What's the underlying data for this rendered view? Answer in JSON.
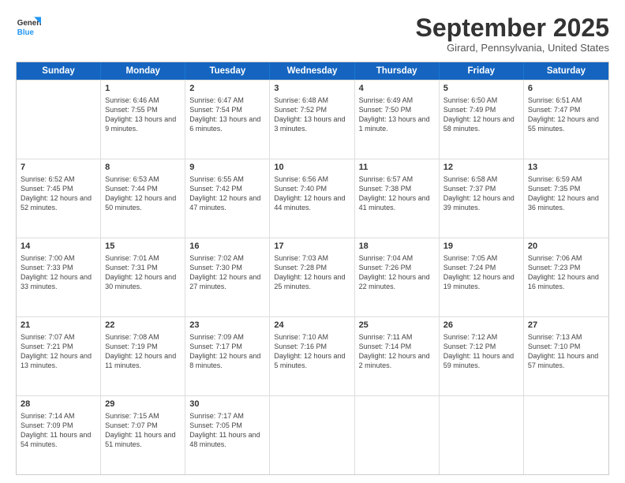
{
  "logo": {
    "general": "General",
    "blue": "Blue"
  },
  "title": "September 2025",
  "location": "Girard, Pennsylvania, United States",
  "days_of_week": [
    "Sunday",
    "Monday",
    "Tuesday",
    "Wednesday",
    "Thursday",
    "Friday",
    "Saturday"
  ],
  "weeks": [
    [
      {
        "day": "",
        "sunrise": "",
        "sunset": "",
        "daylight": ""
      },
      {
        "day": "1",
        "sunrise": "Sunrise: 6:46 AM",
        "sunset": "Sunset: 7:55 PM",
        "daylight": "Daylight: 13 hours and 9 minutes."
      },
      {
        "day": "2",
        "sunrise": "Sunrise: 6:47 AM",
        "sunset": "Sunset: 7:54 PM",
        "daylight": "Daylight: 13 hours and 6 minutes."
      },
      {
        "day": "3",
        "sunrise": "Sunrise: 6:48 AM",
        "sunset": "Sunset: 7:52 PM",
        "daylight": "Daylight: 13 hours and 3 minutes."
      },
      {
        "day": "4",
        "sunrise": "Sunrise: 6:49 AM",
        "sunset": "Sunset: 7:50 PM",
        "daylight": "Daylight: 13 hours and 1 minute."
      },
      {
        "day": "5",
        "sunrise": "Sunrise: 6:50 AM",
        "sunset": "Sunset: 7:49 PM",
        "daylight": "Daylight: 12 hours and 58 minutes."
      },
      {
        "day": "6",
        "sunrise": "Sunrise: 6:51 AM",
        "sunset": "Sunset: 7:47 PM",
        "daylight": "Daylight: 12 hours and 55 minutes."
      }
    ],
    [
      {
        "day": "7",
        "sunrise": "Sunrise: 6:52 AM",
        "sunset": "Sunset: 7:45 PM",
        "daylight": "Daylight: 12 hours and 52 minutes."
      },
      {
        "day": "8",
        "sunrise": "Sunrise: 6:53 AM",
        "sunset": "Sunset: 7:44 PM",
        "daylight": "Daylight: 12 hours and 50 minutes."
      },
      {
        "day": "9",
        "sunrise": "Sunrise: 6:55 AM",
        "sunset": "Sunset: 7:42 PM",
        "daylight": "Daylight: 12 hours and 47 minutes."
      },
      {
        "day": "10",
        "sunrise": "Sunrise: 6:56 AM",
        "sunset": "Sunset: 7:40 PM",
        "daylight": "Daylight: 12 hours and 44 minutes."
      },
      {
        "day": "11",
        "sunrise": "Sunrise: 6:57 AM",
        "sunset": "Sunset: 7:38 PM",
        "daylight": "Daylight: 12 hours and 41 minutes."
      },
      {
        "day": "12",
        "sunrise": "Sunrise: 6:58 AM",
        "sunset": "Sunset: 7:37 PM",
        "daylight": "Daylight: 12 hours and 39 minutes."
      },
      {
        "day": "13",
        "sunrise": "Sunrise: 6:59 AM",
        "sunset": "Sunset: 7:35 PM",
        "daylight": "Daylight: 12 hours and 36 minutes."
      }
    ],
    [
      {
        "day": "14",
        "sunrise": "Sunrise: 7:00 AM",
        "sunset": "Sunset: 7:33 PM",
        "daylight": "Daylight: 12 hours and 33 minutes."
      },
      {
        "day": "15",
        "sunrise": "Sunrise: 7:01 AM",
        "sunset": "Sunset: 7:31 PM",
        "daylight": "Daylight: 12 hours and 30 minutes."
      },
      {
        "day": "16",
        "sunrise": "Sunrise: 7:02 AM",
        "sunset": "Sunset: 7:30 PM",
        "daylight": "Daylight: 12 hours and 27 minutes."
      },
      {
        "day": "17",
        "sunrise": "Sunrise: 7:03 AM",
        "sunset": "Sunset: 7:28 PM",
        "daylight": "Daylight: 12 hours and 25 minutes."
      },
      {
        "day": "18",
        "sunrise": "Sunrise: 7:04 AM",
        "sunset": "Sunset: 7:26 PM",
        "daylight": "Daylight: 12 hours and 22 minutes."
      },
      {
        "day": "19",
        "sunrise": "Sunrise: 7:05 AM",
        "sunset": "Sunset: 7:24 PM",
        "daylight": "Daylight: 12 hours and 19 minutes."
      },
      {
        "day": "20",
        "sunrise": "Sunrise: 7:06 AM",
        "sunset": "Sunset: 7:23 PM",
        "daylight": "Daylight: 12 hours and 16 minutes."
      }
    ],
    [
      {
        "day": "21",
        "sunrise": "Sunrise: 7:07 AM",
        "sunset": "Sunset: 7:21 PM",
        "daylight": "Daylight: 12 hours and 13 minutes."
      },
      {
        "day": "22",
        "sunrise": "Sunrise: 7:08 AM",
        "sunset": "Sunset: 7:19 PM",
        "daylight": "Daylight: 12 hours and 11 minutes."
      },
      {
        "day": "23",
        "sunrise": "Sunrise: 7:09 AM",
        "sunset": "Sunset: 7:17 PM",
        "daylight": "Daylight: 12 hours and 8 minutes."
      },
      {
        "day": "24",
        "sunrise": "Sunrise: 7:10 AM",
        "sunset": "Sunset: 7:16 PM",
        "daylight": "Daylight: 12 hours and 5 minutes."
      },
      {
        "day": "25",
        "sunrise": "Sunrise: 7:11 AM",
        "sunset": "Sunset: 7:14 PM",
        "daylight": "Daylight: 12 hours and 2 minutes."
      },
      {
        "day": "26",
        "sunrise": "Sunrise: 7:12 AM",
        "sunset": "Sunset: 7:12 PM",
        "daylight": "Daylight: 11 hours and 59 minutes."
      },
      {
        "day": "27",
        "sunrise": "Sunrise: 7:13 AM",
        "sunset": "Sunset: 7:10 PM",
        "daylight": "Daylight: 11 hours and 57 minutes."
      }
    ],
    [
      {
        "day": "28",
        "sunrise": "Sunrise: 7:14 AM",
        "sunset": "Sunset: 7:09 PM",
        "daylight": "Daylight: 11 hours and 54 minutes."
      },
      {
        "day": "29",
        "sunrise": "Sunrise: 7:15 AM",
        "sunset": "Sunset: 7:07 PM",
        "daylight": "Daylight: 11 hours and 51 minutes."
      },
      {
        "day": "30",
        "sunrise": "Sunrise: 7:17 AM",
        "sunset": "Sunset: 7:05 PM",
        "daylight": "Daylight: 11 hours and 48 minutes."
      },
      {
        "day": "",
        "sunrise": "",
        "sunset": "",
        "daylight": ""
      },
      {
        "day": "",
        "sunrise": "",
        "sunset": "",
        "daylight": ""
      },
      {
        "day": "",
        "sunrise": "",
        "sunset": "",
        "daylight": ""
      },
      {
        "day": "",
        "sunrise": "",
        "sunset": "",
        "daylight": ""
      }
    ]
  ]
}
